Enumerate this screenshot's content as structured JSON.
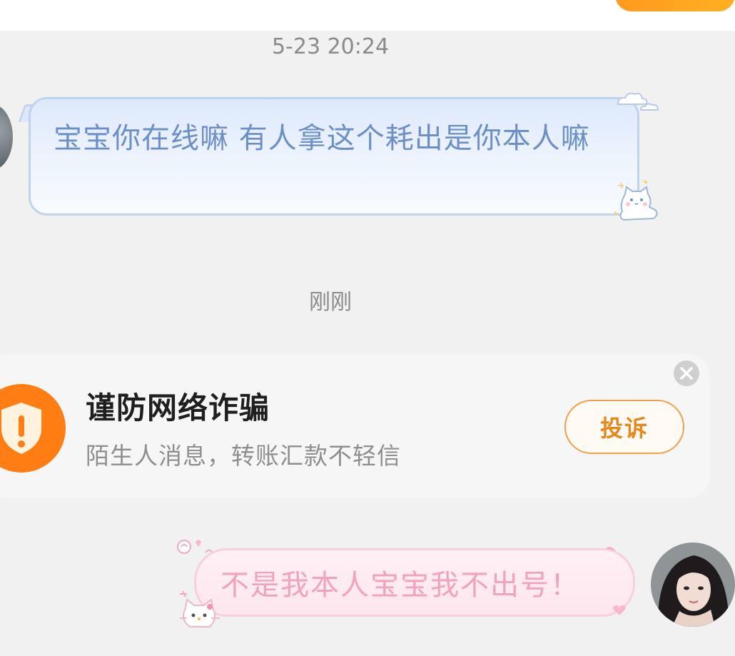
{
  "messages": {
    "timestamp_1": "5-23 20:24",
    "incoming_text": "宝宝你在线嘛 有人拿这个耗出是你本人嘛",
    "timestamp_2": "刚刚",
    "outgoing_text": "不是我本人宝宝我不出号！"
  },
  "warning_card": {
    "title": "谨防网络诈骗",
    "subtitle": "陌生人消息，转账汇款不轻信",
    "report_label": "投诉"
  },
  "colors": {
    "page_bg": "#f1f1f1",
    "incoming_text": "#6b8fc6",
    "outgoing_text": "#f0a3ba",
    "accent_orange": "#ff8a1a"
  },
  "icons": {
    "shield": "shield-exclamation-icon",
    "close": "close-icon",
    "cloud": "cloud-icon",
    "cat": "cat-icon",
    "kitty": "kitty-icon"
  }
}
